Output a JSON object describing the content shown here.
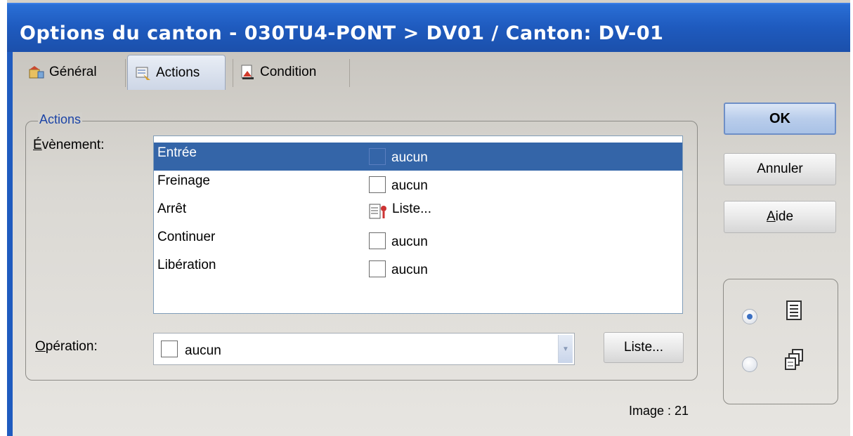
{
  "window": {
    "title": "Options du canton - 030TU4-PONT > DV01 / Canton: DV-01"
  },
  "tabs": [
    {
      "label": "Général",
      "icon": "general-tab-icon"
    },
    {
      "label": "Actions",
      "icon": "actions-tab-icon",
      "active": true
    },
    {
      "label": "Condition",
      "icon": "condition-tab-icon"
    }
  ],
  "group": {
    "title": "Actions"
  },
  "event": {
    "label_underlined": "É",
    "label_rest": "vènement:",
    "rows": [
      {
        "name": "Entrée",
        "value": "aucun",
        "selected": true
      },
      {
        "name": "Freinage",
        "value": "aucun"
      },
      {
        "name": "Arrêt",
        "value": "Liste...",
        "icon": "list-document-icon"
      },
      {
        "name": "Continuer",
        "value": "aucun"
      },
      {
        "name": "Libération",
        "value": "aucun"
      }
    ]
  },
  "operation": {
    "label_underlined": "O",
    "label_rest": "pération:",
    "value": "aucun",
    "list_button": "Liste..."
  },
  "buttons": {
    "ok": "OK",
    "cancel": "Annuler",
    "help_underlined": "A",
    "help_rest": "ide"
  },
  "view_options": [
    {
      "icon": "list-view-icon",
      "selected": true
    },
    {
      "icon": "cascade-view-icon",
      "selected": false
    }
  ],
  "status": "Image : 21",
  "colors": {
    "titlebar": "#1f5bbf",
    "selection": "#3465a8",
    "group_title": "#1c44a6"
  }
}
